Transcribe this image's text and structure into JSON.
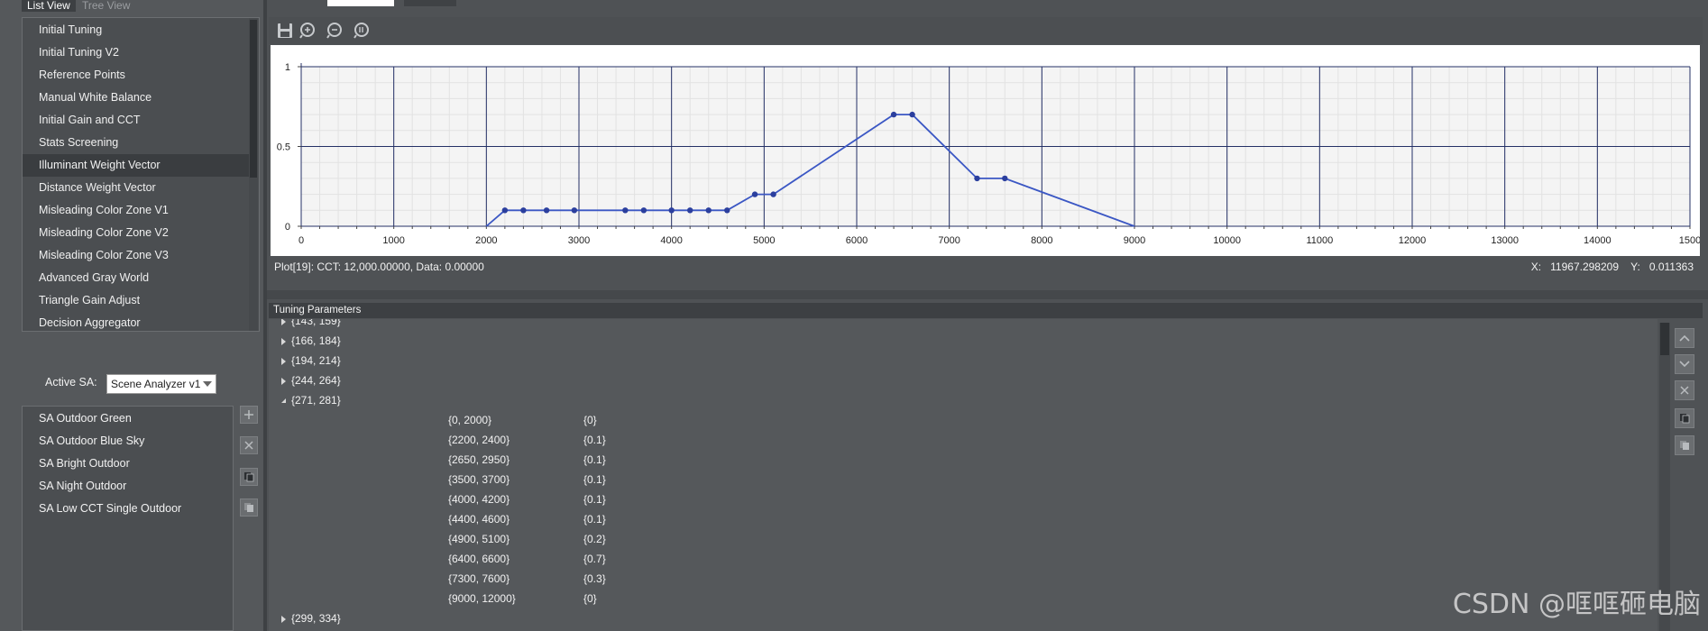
{
  "view_tabs": {
    "list": "List View",
    "tree": "Tree View"
  },
  "algorithms": [
    "Initial Tuning",
    "Initial Tuning V2",
    "Reference Points",
    "Manual White Balance",
    "Initial Gain and CCT",
    "Stats Screening",
    "Illuminant Weight Vector",
    "Distance Weight Vector",
    "Misleading Color Zone V1",
    "Misleading Color Zone V2",
    "Misleading Color Zone V3",
    "Advanced Gray World",
    "Triangle Gain Adjust",
    "Decision Aggregator"
  ],
  "selected_algorithm": "Illuminant Weight Vector",
  "active_sa": {
    "label": "Active SA:",
    "value": "Scene Analyzer v1"
  },
  "sa_items": [
    "SA Outdoor Green",
    "SA Outdoor Blue Sky",
    "SA Bright Outdoor",
    "SA Night Outdoor",
    "SA Low CCT Single Outdoor"
  ],
  "plot": {
    "status": "Plot[19]: CCT: 12,000.00000, Data: 0.00000",
    "x_label": "X:",
    "x_value": "11967.298209",
    "y_label": "Y:",
    "y_value": "0.011363"
  },
  "chart_data": {
    "type": "line",
    "xlim": [
      0,
      15000
    ],
    "ylim": [
      0,
      1
    ],
    "x_ticks": [
      "0",
      "1000",
      "2000",
      "3000",
      "4000",
      "5000",
      "6000",
      "7000",
      "8000",
      "9000",
      "10000",
      "11000",
      "12000",
      "13000",
      "14000",
      "1500"
    ],
    "y_ticks": [
      "0",
      "0.5",
      "1"
    ],
    "series": [
      {
        "x": [
          2000,
          2200,
          2400,
          2650,
          2950,
          3500,
          3700,
          4000,
          4200,
          4400,
          4600,
          4900,
          5100,
          6400,
          6600,
          7300,
          7600,
          9000
        ],
        "y": [
          0,
          0.1,
          0.1,
          0.1,
          0.1,
          0.1,
          0.1,
          0.1,
          0.1,
          0.1,
          0.1,
          0.2,
          0.2,
          0.7,
          0.7,
          0.3,
          0.3,
          0
        ]
      }
    ],
    "line_color": "#3b57c4",
    "grid": true
  },
  "tuning": {
    "header": "Tuning Parameters",
    "collapsed_before": [
      "{143, 159}",
      "{166, 184}",
      "{194, 214}",
      "{244, 264}"
    ],
    "expanded": "{271, 281}",
    "rows": [
      {
        "range": "{0, 2000}",
        "value": "{0}"
      },
      {
        "range": "{2200, 2400}",
        "value": "{0.1}"
      },
      {
        "range": "{2650, 2950}",
        "value": "{0.1}"
      },
      {
        "range": "{3500, 3700}",
        "value": "{0.1}"
      },
      {
        "range": "{4000, 4200}",
        "value": "{0.1}"
      },
      {
        "range": "{4400, 4600}",
        "value": "{0.1}"
      },
      {
        "range": "{4900, 5100}",
        "value": "{0.2}"
      },
      {
        "range": "{6400, 6600}",
        "value": "{0.7}"
      },
      {
        "range": "{7300, 7600}",
        "value": "{0.3}"
      },
      {
        "range": "{9000, 12000}",
        "value": "{0}"
      }
    ],
    "collapsed_after": [
      "{299, 334}"
    ]
  },
  "watermark": "CSDN @哐哐砸电脑"
}
